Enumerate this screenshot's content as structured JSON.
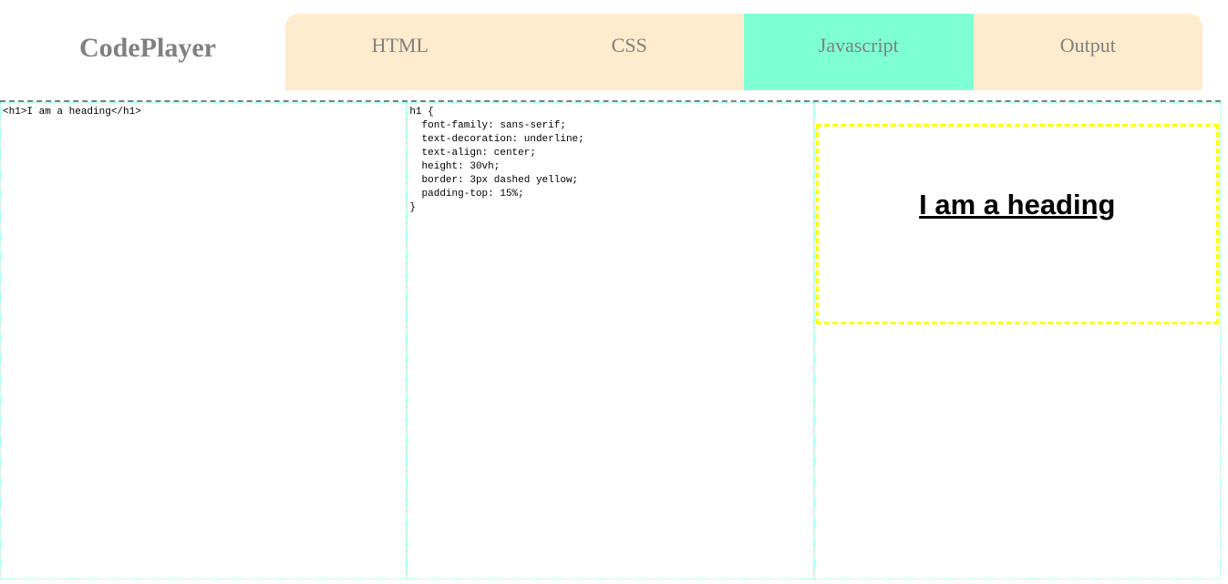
{
  "header": {
    "logo": "CodePlayer"
  },
  "tabs": [
    {
      "label": "HTML",
      "active": false
    },
    {
      "label": "CSS",
      "active": false
    },
    {
      "label": "Javascript",
      "active": true
    },
    {
      "label": "Output",
      "active": false
    }
  ],
  "editors": {
    "html": "<h1>I am a heading</h1>",
    "css": "h1 {\n  font-family: sans-serif;\n  text-decoration: underline;\n  text-align: center;\n  height: 30vh;\n  border: 3px dashed yellow;\n  padding-top: 15%;\n}"
  },
  "output": {
    "heading": "I am a heading"
  },
  "colors": {
    "tab_bg": "#ffebcd",
    "active_tab": "#7fffd4",
    "heading_border": "#ffff00"
  }
}
